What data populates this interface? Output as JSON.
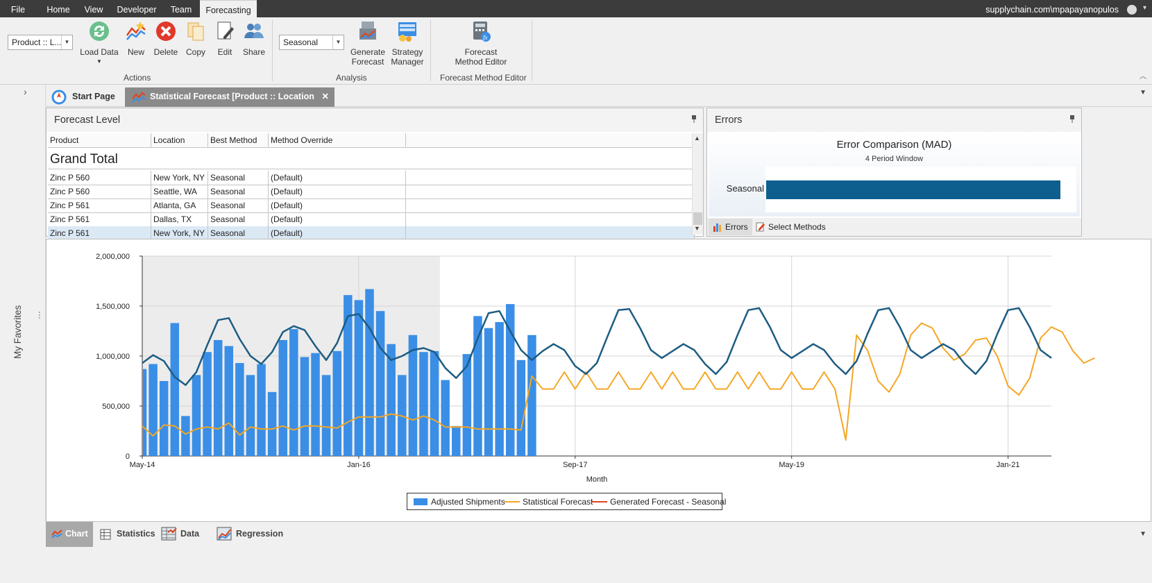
{
  "menu": {
    "file": "File",
    "tabs": [
      "Home",
      "View",
      "Developer",
      "Team",
      "Forecasting"
    ],
    "active_tab": "Forecasting",
    "account": "supplychain.com\\mpapayanopulos"
  },
  "ribbon": {
    "level_combo": "Product :: L...",
    "actions": {
      "load_data": "Load Data",
      "new": "New",
      "delete": "Delete",
      "copy": "Copy",
      "edit": "Edit",
      "share": "Share",
      "group_label": "Actions"
    },
    "analysis": {
      "method_combo": "Seasonal",
      "generate_1": "Generate",
      "generate_2": "Forecast",
      "strategy_1": "Strategy",
      "strategy_2": "Manager",
      "group_label": "Analysis"
    },
    "editor": {
      "btn_1": "Forecast",
      "btn_2": "Method Editor",
      "group_label": "Forecast Method Editor"
    }
  },
  "sidebar": {
    "favorites": "My Favorites"
  },
  "doc_tabs": {
    "start": "Start Page",
    "active": "Statistical Forecast [Product :: Location _SM]*"
  },
  "forecast_level": {
    "title": "Forecast Level",
    "columns": [
      "Product",
      "Location",
      "Best Method",
      "Method Override"
    ],
    "grand_total": "Grand Total",
    "rows": [
      [
        "Zinc P 560",
        "New York, NY",
        "Seasonal",
        "(Default)"
      ],
      [
        "Zinc P 560",
        "Seattle, WA",
        "Seasonal",
        "(Default)"
      ],
      [
        "Zinc P 561",
        "Atlanta, GA",
        "Seasonal",
        "(Default)"
      ],
      [
        "Zinc P 561",
        "Dallas, TX",
        "Seasonal",
        "(Default)"
      ],
      [
        "Zinc P 561",
        "New York, NY",
        "Seasonal",
        "(Default)"
      ]
    ]
  },
  "errors": {
    "title": "Errors",
    "chart_title": "Error Comparison (MAD)",
    "chart_subtitle": "4 Period Window",
    "bar_label": "Seasonal",
    "tab_errors": "Errors",
    "tab_select": "Select Methods"
  },
  "chart_data": {
    "type": "line",
    "xlabel": "Month",
    "ylabel": "",
    "ylim": [
      0,
      2000000
    ],
    "y_ticks": [
      "2,000,000",
      "1,500,000",
      "1,000,000",
      "500,000",
      "0"
    ],
    "x_ticks": [
      "May-14",
      "Jan-16",
      "Sep-17",
      "May-19",
      "Jan-21"
    ],
    "history_end_index": 27,
    "series": [
      {
        "name": "Adjusted Shipments",
        "kind": "bar",
        "color": "#3a8ee6",
        "values": [
          870000,
          920000,
          750000,
          1330000,
          400000,
          810000,
          1040000,
          1160000,
          1100000,
          930000,
          810000,
          920000,
          640000,
          1160000,
          1270000,
          990000,
          1030000,
          810000,
          1050000,
          1610000,
          1560000,
          1670000,
          1450000,
          1120000,
          810000,
          1210000,
          1040000,
          1050000,
          760000,
          300000,
          1020000,
          1400000,
          1280000,
          1340000,
          1520000,
          960000,
          1210000
        ]
      },
      {
        "name": "Statistical Forecast",
        "kind": "line",
        "color": "#f5a623",
        "values": [
          300000,
          200000,
          310000,
          300000,
          220000,
          270000,
          290000,
          270000,
          330000,
          210000,
          290000,
          270000,
          270000,
          300000,
          260000,
          300000,
          300000,
          290000,
          280000,
          340000,
          390000,
          390000,
          390000,
          420000,
          400000,
          360000,
          400000,
          360000,
          290000,
          290000,
          290000,
          270000,
          270000,
          270000,
          270000,
          260000,
          800000,
          670000,
          670000,
          840000,
          670000,
          840000,
          670000,
          670000,
          840000,
          670000,
          670000,
          840000,
          670000,
          840000,
          670000,
          670000,
          840000,
          670000,
          670000,
          840000,
          670000,
          840000,
          670000,
          670000,
          840000,
          670000,
          670000,
          840000,
          670000,
          160000,
          1210000,
          1060000,
          750000,
          640000,
          820000,
          1210000,
          1330000,
          1280000,
          1080000,
          960000,
          1020000,
          1160000,
          1180000,
          1000000,
          700000,
          610000,
          780000,
          1180000,
          1290000,
          1240000,
          1050000,
          930000,
          980000
        ]
      },
      {
        "name": "Generated Forecast - Seasonal",
        "kind": "line",
        "color": "#1d5c82",
        "values": [
          930000,
          1010000,
          950000,
          790000,
          710000,
          840000,
          1110000,
          1360000,
          1380000,
          1170000,
          1000000,
          920000,
          1040000,
          1240000,
          1300000,
          1260000,
          1100000,
          960000,
          1130000,
          1400000,
          1420000,
          1280000,
          1080000,
          960000,
          1000000,
          1060000,
          1080000,
          1040000,
          880000,
          780000,
          900000,
          1180000,
          1430000,
          1450000,
          1250000,
          1060000,
          960000,
          1050000,
          1120000,
          1060000,
          900000,
          820000,
          930000,
          1200000,
          1460000,
          1470000,
          1280000,
          1060000,
          980000,
          1050000,
          1120000,
          1060000,
          920000,
          820000,
          940000,
          1210000,
          1460000,
          1480000,
          1290000,
          1060000,
          980000,
          1050000,
          1120000,
          1060000,
          920000,
          820000,
          950000,
          1220000,
          1460000,
          1480000,
          1290000,
          1060000,
          980000,
          1050000,
          1120000,
          1060000,
          920000,
          820000,
          950000,
          1220000,
          1460000,
          1480000,
          1290000,
          1060000,
          980000
        ]
      }
    ],
    "legend_placement": "bottom"
  },
  "view_tabs": {
    "chart": "Chart",
    "statistics": "Statistics",
    "data": "Data",
    "regression": "Regression"
  },
  "colors": {
    "bar": "#3a8ee6",
    "stat": "#f5a623",
    "seasonal": "#1d5c82",
    "error_bar": "#0e5f8e",
    "generated_legend": "#e0421b"
  }
}
